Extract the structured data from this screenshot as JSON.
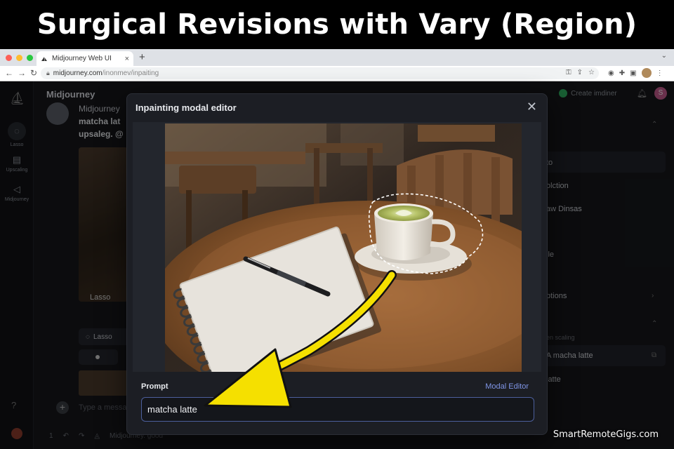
{
  "headline": "Surgical Revisions with Vary (Region)",
  "browser": {
    "tab_title": "Midjourney Web UI",
    "url_host": "midjourney.com",
    "url_path": "/inonmev/inpaiting",
    "new_tab_glyph": "+",
    "tab_close_glyph": "×"
  },
  "app": {
    "brand": "Midjourney",
    "rail": [
      {
        "label": "Lasso",
        "icon": "chat-bubble-icon"
      },
      {
        "label": "Upscaling",
        "icon": "document-icon"
      },
      {
        "label": "Midjourney",
        "icon": "megaphone-icon"
      }
    ],
    "chat": {
      "line1": "Midjourney",
      "line2": "matcha lat",
      "line3": "upsaleg. @",
      "image_label": "Lasso",
      "lasso_button": "Lasso",
      "input_placeholder": "Type a messa",
      "bottom_number": "1",
      "bottom_text": "Midjourney. good"
    },
    "create_button": "Create imdiner",
    "user_initial": "S",
    "right_panel": [
      "to",
      "olction",
      "aw Dinsas",
      "ile",
      "ptions",
      "en scaling",
      "A macha latte",
      "latte"
    ]
  },
  "modal": {
    "title": "Inpainting modal editor",
    "close_glyph": "✕",
    "prompt_label": "Prompt",
    "editor_link": "Modal Editor",
    "prompt_value": "matcha latte"
  },
  "colors": {
    "annotation_arrow": "#f5e000",
    "selection_outline": "#ffffff",
    "link": "#7f95e6"
  },
  "watermark": "SmartRemoteGigs.com"
}
